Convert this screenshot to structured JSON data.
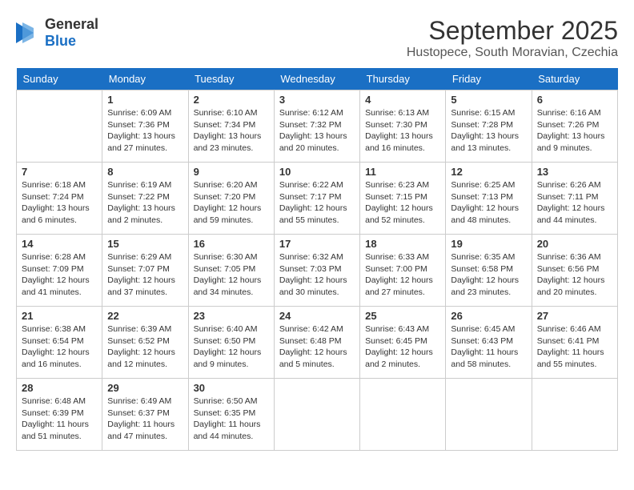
{
  "header": {
    "logo_general": "General",
    "logo_blue": "Blue",
    "month_title": "September 2025",
    "location": "Hustopece, South Moravian, Czechia"
  },
  "weekdays": [
    "Sunday",
    "Monday",
    "Tuesday",
    "Wednesday",
    "Thursday",
    "Friday",
    "Saturday"
  ],
  "weeks": [
    [
      {
        "day": "",
        "info": ""
      },
      {
        "day": "1",
        "info": "Sunrise: 6:09 AM\nSunset: 7:36 PM\nDaylight: 13 hours\nand 27 minutes."
      },
      {
        "day": "2",
        "info": "Sunrise: 6:10 AM\nSunset: 7:34 PM\nDaylight: 13 hours\nand 23 minutes."
      },
      {
        "day": "3",
        "info": "Sunrise: 6:12 AM\nSunset: 7:32 PM\nDaylight: 13 hours\nand 20 minutes."
      },
      {
        "day": "4",
        "info": "Sunrise: 6:13 AM\nSunset: 7:30 PM\nDaylight: 13 hours\nand 16 minutes."
      },
      {
        "day": "5",
        "info": "Sunrise: 6:15 AM\nSunset: 7:28 PM\nDaylight: 13 hours\nand 13 minutes."
      },
      {
        "day": "6",
        "info": "Sunrise: 6:16 AM\nSunset: 7:26 PM\nDaylight: 13 hours\nand 9 minutes."
      }
    ],
    [
      {
        "day": "7",
        "info": "Sunrise: 6:18 AM\nSunset: 7:24 PM\nDaylight: 13 hours\nand 6 minutes."
      },
      {
        "day": "8",
        "info": "Sunrise: 6:19 AM\nSunset: 7:22 PM\nDaylight: 13 hours\nand 2 minutes."
      },
      {
        "day": "9",
        "info": "Sunrise: 6:20 AM\nSunset: 7:20 PM\nDaylight: 12 hours\nand 59 minutes."
      },
      {
        "day": "10",
        "info": "Sunrise: 6:22 AM\nSunset: 7:17 PM\nDaylight: 12 hours\nand 55 minutes."
      },
      {
        "day": "11",
        "info": "Sunrise: 6:23 AM\nSunset: 7:15 PM\nDaylight: 12 hours\nand 52 minutes."
      },
      {
        "day": "12",
        "info": "Sunrise: 6:25 AM\nSunset: 7:13 PM\nDaylight: 12 hours\nand 48 minutes."
      },
      {
        "day": "13",
        "info": "Sunrise: 6:26 AM\nSunset: 7:11 PM\nDaylight: 12 hours\nand 44 minutes."
      }
    ],
    [
      {
        "day": "14",
        "info": "Sunrise: 6:28 AM\nSunset: 7:09 PM\nDaylight: 12 hours\nand 41 minutes."
      },
      {
        "day": "15",
        "info": "Sunrise: 6:29 AM\nSunset: 7:07 PM\nDaylight: 12 hours\nand 37 minutes."
      },
      {
        "day": "16",
        "info": "Sunrise: 6:30 AM\nSunset: 7:05 PM\nDaylight: 12 hours\nand 34 minutes."
      },
      {
        "day": "17",
        "info": "Sunrise: 6:32 AM\nSunset: 7:03 PM\nDaylight: 12 hours\nand 30 minutes."
      },
      {
        "day": "18",
        "info": "Sunrise: 6:33 AM\nSunset: 7:00 PM\nDaylight: 12 hours\nand 27 minutes."
      },
      {
        "day": "19",
        "info": "Sunrise: 6:35 AM\nSunset: 6:58 PM\nDaylight: 12 hours\nand 23 minutes."
      },
      {
        "day": "20",
        "info": "Sunrise: 6:36 AM\nSunset: 6:56 PM\nDaylight: 12 hours\nand 20 minutes."
      }
    ],
    [
      {
        "day": "21",
        "info": "Sunrise: 6:38 AM\nSunset: 6:54 PM\nDaylight: 12 hours\nand 16 minutes."
      },
      {
        "day": "22",
        "info": "Sunrise: 6:39 AM\nSunset: 6:52 PM\nDaylight: 12 hours\nand 12 minutes."
      },
      {
        "day": "23",
        "info": "Sunrise: 6:40 AM\nSunset: 6:50 PM\nDaylight: 12 hours\nand 9 minutes."
      },
      {
        "day": "24",
        "info": "Sunrise: 6:42 AM\nSunset: 6:48 PM\nDaylight: 12 hours\nand 5 minutes."
      },
      {
        "day": "25",
        "info": "Sunrise: 6:43 AM\nSunset: 6:45 PM\nDaylight: 12 hours\nand 2 minutes."
      },
      {
        "day": "26",
        "info": "Sunrise: 6:45 AM\nSunset: 6:43 PM\nDaylight: 11 hours\nand 58 minutes."
      },
      {
        "day": "27",
        "info": "Sunrise: 6:46 AM\nSunset: 6:41 PM\nDaylight: 11 hours\nand 55 minutes."
      }
    ],
    [
      {
        "day": "28",
        "info": "Sunrise: 6:48 AM\nSunset: 6:39 PM\nDaylight: 11 hours\nand 51 minutes."
      },
      {
        "day": "29",
        "info": "Sunrise: 6:49 AM\nSunset: 6:37 PM\nDaylight: 11 hours\nand 47 minutes."
      },
      {
        "day": "30",
        "info": "Sunrise: 6:50 AM\nSunset: 6:35 PM\nDaylight: 11 hours\nand 44 minutes."
      },
      {
        "day": "",
        "info": ""
      },
      {
        "day": "",
        "info": ""
      },
      {
        "day": "",
        "info": ""
      },
      {
        "day": "",
        "info": ""
      }
    ]
  ]
}
